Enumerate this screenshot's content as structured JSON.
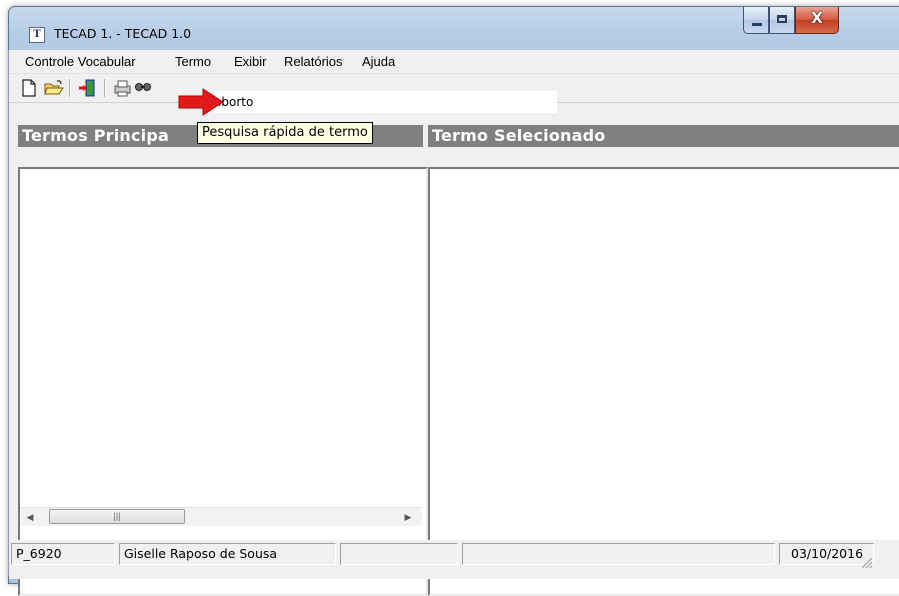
{
  "window": {
    "title": "TECAD 1.  - TECAD 1.0",
    "app_icon_glyph": "T",
    "close_glyph": "X"
  },
  "menu": {
    "items": [
      "Controle Vocabular",
      "Termo",
      "Exibir",
      "Relatórios",
      "Ajuda"
    ]
  },
  "toolbar": {
    "icons": [
      "new-file-icon",
      "open-folder-icon",
      "exit-door-icon",
      "print-icon",
      "search-term-icon"
    ]
  },
  "search": {
    "value": "aborto",
    "tooltip": "Pesquisa rápida de termo"
  },
  "panels": {
    "left_title": "Termos Principa",
    "right_title": "Termo Selecionado"
  },
  "statusbar": {
    "cells": [
      "P_6920",
      "Giselle Raposo de Sousa",
      "",
      "",
      "03/10/2016"
    ]
  },
  "colors": {
    "panel_header": "#808080",
    "tooltip_bg": "#ffffe1",
    "annotation_arrow": "#e11b1b"
  }
}
